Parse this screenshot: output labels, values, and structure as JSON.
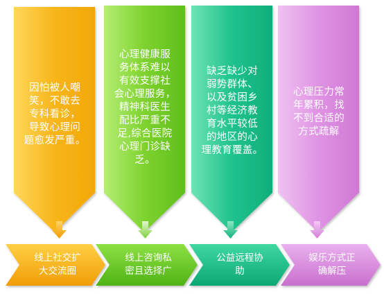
{
  "problems": [
    {
      "text": "因怕被人嘲\n笑，不敢去\n专科看诊，\n导致心理问\n题愈发严重。",
      "color": "#f6b51d"
    },
    {
      "text": "心理健康服\n务体系难以\n有效支撑社\n会心理服务，\n精神科医生\n配比严重不\n足,综合医院\n心理门诊缺\n乏。",
      "color": "#7ed22f"
    },
    {
      "text": "缺乏缺少对\n弱势群体、\n以及贫困乡\n村等经济教\n育水平较低\n的地区的心\n理教育覆盖。",
      "color": "#1fc08c"
    },
    {
      "text": "心理压力常\n年累积，找\n不到合适的\n方式疏解",
      "color": "#dc8ee0"
    }
  ],
  "solutions": [
    {
      "text": "线上社交扩\n大交流圈",
      "color": "#f4ad12"
    },
    {
      "text": "线上咨询私\n密且选择广",
      "color": "#5fc62a"
    },
    {
      "text": "公益远程协\n助",
      "color": "#19bd8b"
    },
    {
      "text": "娱乐方式正\n确解压",
      "color": "#d783de"
    }
  ]
}
